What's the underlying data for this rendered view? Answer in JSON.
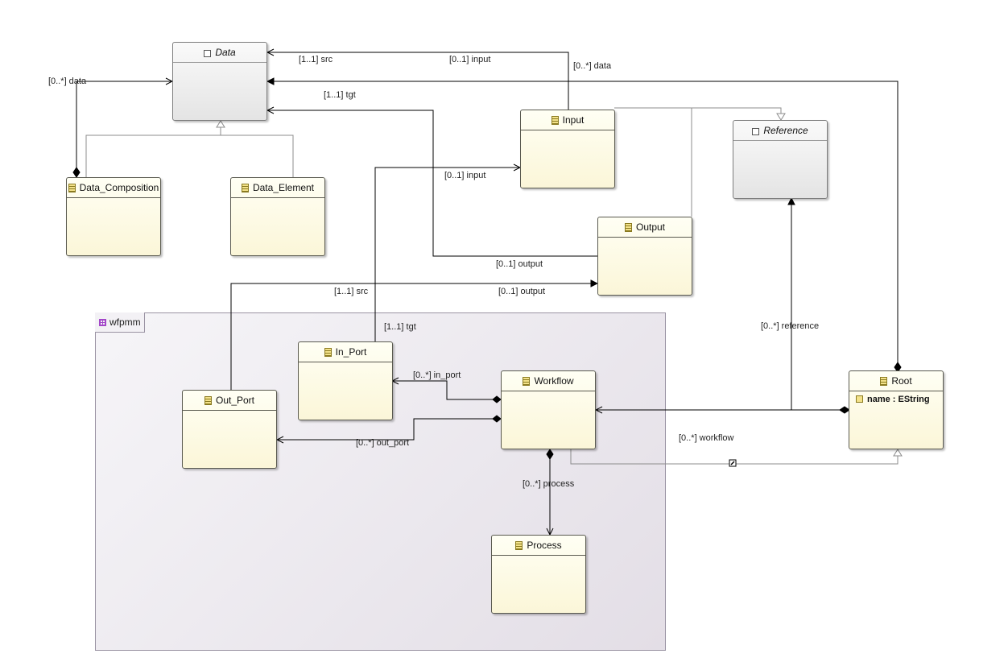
{
  "package": {
    "name": "wfpmm",
    "icon": "package-icon"
  },
  "classes": {
    "data": {
      "name": "Data",
      "abstract": true
    },
    "data_composition": {
      "name": "Data_Composition"
    },
    "data_element": {
      "name": "Data_Element"
    },
    "input": {
      "name": "Input"
    },
    "reference": {
      "name": "Reference",
      "abstract": true
    },
    "output": {
      "name": "Output"
    },
    "in_port": {
      "name": "In_Port"
    },
    "out_port": {
      "name": "Out_Port"
    },
    "workflow": {
      "name": "Workflow"
    },
    "process": {
      "name": "Process"
    },
    "root": {
      "name": "Root",
      "attribute": "name : EString"
    }
  },
  "labels": {
    "data_src": "[1..1] src",
    "data_tgt": "[1..1] tgt",
    "input_to_data": "[0..1] input",
    "root_data": "[0..*] data",
    "composition_data": "[0..*] data",
    "in_port_input": "[0..1] input",
    "data_output": "[0..1] output",
    "out_port_src": "[1..1] src",
    "out_port_output": "[0..1] output",
    "in_port_tgt": "[1..1] tgt",
    "root_reference": "[0..*] reference",
    "workflow_in_port": "[0..*] in_port",
    "workflow_out_port": "[0..*] out_port",
    "root_workflow": "[0..*] workflow",
    "workflow_process": "[0..*] process"
  }
}
